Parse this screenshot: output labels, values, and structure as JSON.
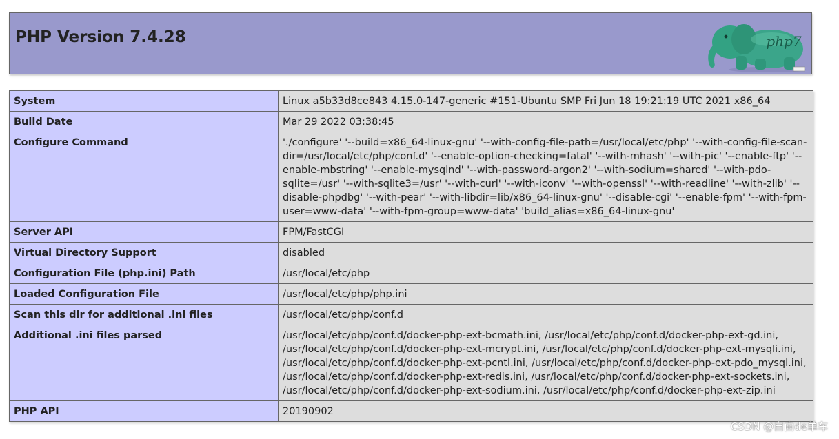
{
  "header": {
    "title": "PHP Version 7.4.28",
    "logo_text": "php7",
    "logo_icon": "php-elephant-logo-icon"
  },
  "rows": [
    {
      "key": "System",
      "value": "Linux a5b33d8ce843 4.15.0-147-generic #151-Ubuntu SMP Fri Jun 18 19:21:19 UTC 2021 x86_64"
    },
    {
      "key": "Build Date",
      "value": "Mar 29 2022 03:38:45"
    },
    {
      "key": "Configure Command",
      "value": "'./configure' '--build=x86_64-linux-gnu' '--with-config-file-path=/usr/local/etc/php' '--with-config-file-scan-dir=/usr/local/etc/php/conf.d' '--enable-option-checking=fatal' '--with-mhash' '--with-pic' '--enable-ftp' '--enable-mbstring' '--enable-mysqlnd' '--with-password-argon2' '--with-sodium=shared' '--with-pdo-sqlite=/usr' '--with-sqlite3=/usr' '--with-curl' '--with-iconv' '--with-openssl' '--with-readline' '--with-zlib' '--disable-phpdbg' '--with-pear' '--with-libdir=lib/x86_64-linux-gnu' '--disable-cgi' '--enable-fpm' '--with-fpm-user=www-data' '--with-fpm-group=www-data' 'build_alias=x86_64-linux-gnu'"
    },
    {
      "key": "Server API",
      "value": "FPM/FastCGI"
    },
    {
      "key": "Virtual Directory Support",
      "value": "disabled"
    },
    {
      "key": "Configuration File (php.ini) Path",
      "value": "/usr/local/etc/php"
    },
    {
      "key": "Loaded Configuration File",
      "value": "/usr/local/etc/php/php.ini"
    },
    {
      "key": "Scan this dir for additional .ini files",
      "value": "/usr/local/etc/php/conf.d"
    },
    {
      "key": "Additional .ini files parsed",
      "value": "/usr/local/etc/php/conf.d/docker-php-ext-bcmath.ini, /usr/local/etc/php/conf.d/docker-php-ext-gd.ini, /usr/local/etc/php/conf.d/docker-php-ext-mcrypt.ini, /usr/local/etc/php/conf.d/docker-php-ext-mysqli.ini, /usr/local/etc/php/conf.d/docker-php-ext-pcntl.ini, /usr/local/etc/php/conf.d/docker-php-ext-pdo_mysql.ini, /usr/local/etc/php/conf.d/docker-php-ext-redis.ini, /usr/local/etc/php/conf.d/docker-php-ext-sockets.ini, /usr/local/etc/php/conf.d/docker-php-ext-sodium.ini, /usr/local/etc/php/conf.d/docker-php-ext-zip.ini"
    },
    {
      "key": "PHP API",
      "value": "20190902"
    }
  ],
  "watermark": "CSDN @自由de单车",
  "colors": {
    "header_bg": "#9999cc",
    "key_cell_bg": "#ccccff",
    "value_cell_bg": "#dddddd",
    "border": "#666666"
  }
}
